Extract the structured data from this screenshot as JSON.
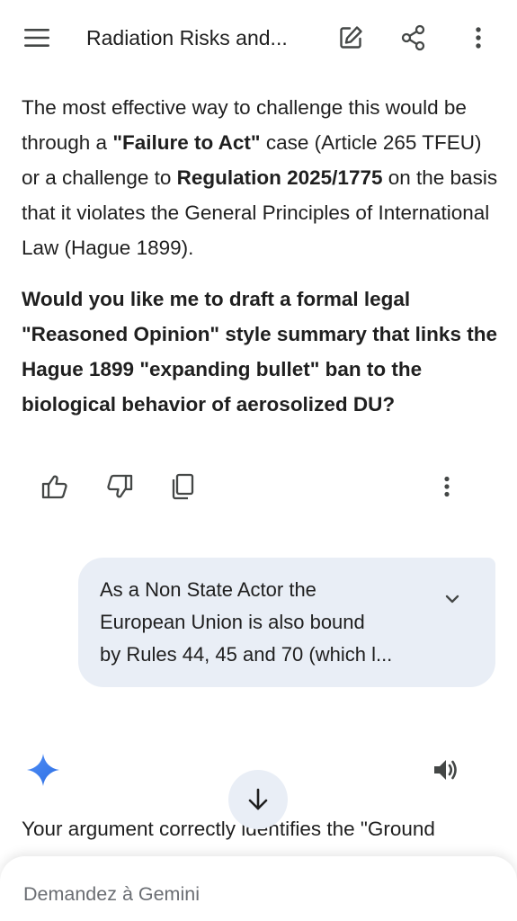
{
  "header": {
    "title": "Radiation Risks and...",
    "icons": [
      "menu-icon",
      "edit-icon",
      "share-icon",
      "more-vert-icon"
    ]
  },
  "response": {
    "para1": {
      "t1": "The most effective way to challenge this would be through a ",
      "b1": "\"Failure to Act\"",
      "t2": " case (Article 265 TFEU) or a challenge to ",
      "b2": "Regulation 2025/1775",
      "t3": " on the basis that it violates the General Principles of International Law (Hague 1899)."
    },
    "question": "Would you like me to draft a formal legal \"Reasoned Opinion\" style summary that links the Hague 1899 \"expanding bullet\" ban to the biological behavior of aerosolized DU?"
  },
  "feedback": {
    "icons": [
      "thumb-up-icon",
      "thumb-down-icon",
      "copy-icon",
      "more-vert-icon"
    ]
  },
  "user_message": {
    "line1": "As a Non State Actor the",
    "line2": "European Union is also bound",
    "line3": "by Rules 44, 45 and 70 (which l..."
  },
  "next_response": {
    "text": "Your argument correctly identifies the \"Ground"
  },
  "input": {
    "placeholder": "Demandez à Gemini"
  },
  "colors": {
    "bubble": "#e9eef6",
    "text": "#1f1f1f",
    "placeholder": "#6b6e73",
    "gemini_blue": "#4285f4"
  }
}
